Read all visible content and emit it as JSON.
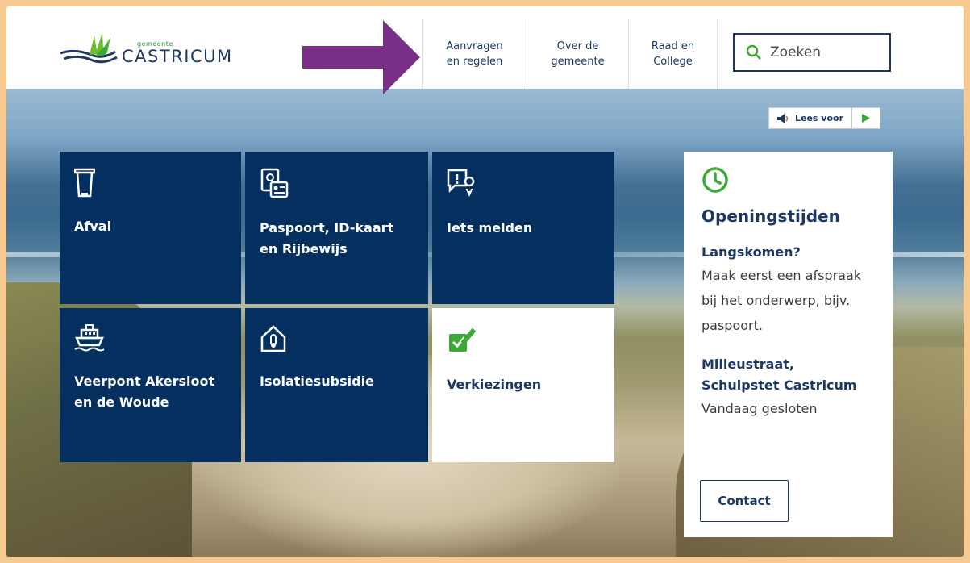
{
  "header": {
    "logo": {
      "small": "gemeente",
      "name": "CASTRICUM"
    },
    "nav": [
      {
        "label": "Aanvragen\nen regelen"
      },
      {
        "label": "Over de\ngemeente"
      },
      {
        "label": "Raad en\nCollege"
      }
    ],
    "search": {
      "placeholder": "Zoeken",
      "icon": "search-icon"
    }
  },
  "read_aloud": {
    "label": "Lees voor",
    "icons": [
      "speaker-icon",
      "play-icon"
    ]
  },
  "tiles": [
    {
      "label": "Afval",
      "icon": "trash-bin-icon"
    },
    {
      "label": "Paspoort, ID-kaart en Rijbewijs",
      "icon": "id-card-icon"
    },
    {
      "label": "Iets melden",
      "icon": "report-location-icon"
    },
    {
      "label": "Veerpont Akersloot en de Woude",
      "icon": "ferry-icon"
    },
    {
      "label": "Isolatiesubsidie",
      "icon": "house-thermometer-icon"
    },
    {
      "label": "Verkiezingen",
      "icon": "ballot-check-icon"
    }
  ],
  "opening_hours": {
    "title": "Openingstijden",
    "icon": "clock-icon",
    "visit_heading": "Langskomen?",
    "visit_text": "Maak eerst een afspraak bij het onderwerp, bijv. paspoort.",
    "location_heading": "Milieustraat, Schulpstet Castricum",
    "location_status": "Vandaag gesloten",
    "contact_label": "Contact"
  },
  "colors": {
    "navy": "#052f5f",
    "text_navy": "#1d3864",
    "green": "#3aa935",
    "arrow_purple": "#7a2f87",
    "frame": "#f5c98f"
  }
}
